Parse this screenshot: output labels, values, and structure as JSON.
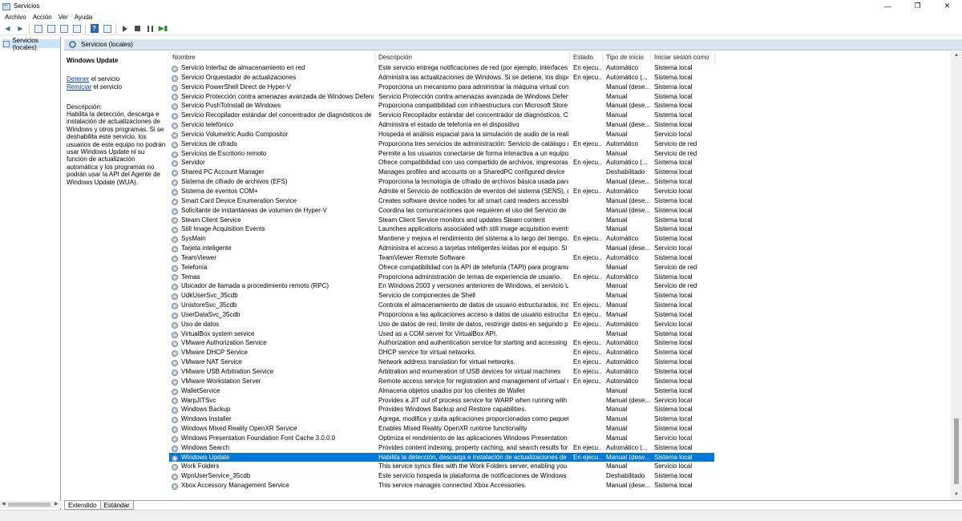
{
  "window": {
    "title": "Servicios",
    "controls": [
      "—",
      "❐",
      "✕"
    ]
  },
  "menu": [
    "Archivo",
    "Acción",
    "Ver",
    "Ayuda"
  ],
  "tree": {
    "root_label": "Servicios (locales)"
  },
  "pane_header": {
    "title": "Servicios (locales)"
  },
  "details": {
    "service_title": "Windows Update",
    "stop_link": "Detener",
    "stop_suffix": " el servicio",
    "restart_link": "Reiniciar",
    "restart_suffix": " el servicio",
    "description_label": "Descripción:",
    "description_text": "Habilita la detección, descarga e instalación de actualizaciones de Windows y otros programas. Si se deshabilita este servicio, los usuarios de este equipo no podrán usar Windows Update ni su función de actualización automática y los programas no podrán usar la API del Agente de Windows Update (WUA)."
  },
  "columns": {
    "name": "Nombre",
    "description": "Descripción",
    "state": "Estado",
    "startup": "Tipo de inicio",
    "logon": "Iniciar sesión como"
  },
  "services": [
    [
      "Servicio Interfaz de almacenamiento en red",
      "Este servicio entrega notificaciones de red (por ejemplo, interfaces ag...",
      "En ejecu...",
      "Automático",
      "Sistema local"
    ],
    [
      "Servicio Orquestador de actualizaciones",
      "Administra las actualizaciones de Windows. Si se detiene, los dispositi...",
      "En ejecu...",
      "Automático (...",
      "Sistema local"
    ],
    [
      "Servicio PowerShell Direct de Hyper-V",
      "Proporciona un mecanismo para administrar la máquina virtual con ...",
      "",
      "Manual (dese...",
      "Sistema local"
    ],
    [
      "Servicio Protección contra amenazas avanzada de Windows Defender",
      "Servicio Protección contra amenazas avanzada de Windows Defend...",
      "",
      "Manual",
      "Sistema local"
    ],
    [
      "Servicio PushToInstall de Windows",
      "Proporciona compatibilidad con infraestructura con Microsoft Store. E...",
      "",
      "Manual (dese...",
      "Sistema local"
    ],
    [
      "Servicio Recopilador estándar del concentrador de diagnósticos de Micr...",
      "Servicio Recopilador estándar del concentrador de diagnósticos. Cua...",
      "",
      "Manual",
      "Sistema local"
    ],
    [
      "Servicio telefónico",
      "Administra el estado de telefonía en el dispositivo",
      "",
      "Manual (dese...",
      "Sistema local"
    ],
    [
      "Servicio Volumetric Audio Compositor",
      "Hospeda el análisis espacial para la simulación de audio de la realidad...",
      "",
      "Manual",
      "Servicio local"
    ],
    [
      "Servicios de cifrado",
      "Proporciona tres servicios de administración: Servicio de catálogo de ...",
      "En ejecu...",
      "Automático",
      "Servicio de red"
    ],
    [
      "Servicios de Escritorio remoto",
      "Permite a los usuarios conectarse de forma interactiva a un equipo re...",
      "",
      "Manual",
      "Servicio de red"
    ],
    [
      "Servidor",
      "Ofrece compatibilidad con uso compartido de archivos, impresoras y ...",
      "En ejecu...",
      "Automático (...",
      "Sistema local"
    ],
    [
      "Shared PC Account Manager",
      "Manages profiles and accounts on a SharedPC configured device",
      "",
      "Deshabilitado",
      "Sistema local"
    ],
    [
      "Sistema de cifrado de archivos (EFS)",
      "Proporciona la tecnología de cifrado de archivos básica usada para al...",
      "",
      "Manual (dese...",
      "Sistema local"
    ],
    [
      "Sistema de eventos COM+",
      "Admite el Servicio de notificación de eventos del sistema (SENS), que ...",
      "En ejecu...",
      "Automático",
      "Servicio local"
    ],
    [
      "Smart Card Device Enumeration Service",
      "Creates software device nodes for all smart card readers accessible to ...",
      "",
      "Manual (dese...",
      "Sistema local"
    ],
    [
      "Solicitante de instantáneas de volumen de Hyper-V",
      "Coordina las comunicaciones que requieren el uso del Servicio de ins...",
      "",
      "Manual (dese...",
      "Sistema local"
    ],
    [
      "Steam Client Service",
      "Steam Client Service monitors and updates Steam content",
      "",
      "Manual",
      "Sistema local"
    ],
    [
      "Still Image Acquisition Events",
      "Launches applications associated with still image acquisition events.",
      "",
      "Manual",
      "Sistema local"
    ],
    [
      "SysMain",
      "Mantiene y mejora el rendimiento del sistema a lo largo del tiempo.",
      "En ejecu...",
      "Automático",
      "Sistema local"
    ],
    [
      "Tarjeta inteligente",
      "Administra el acceso a tarjetas inteligentes leídas por el equipo. Si se ...",
      "",
      "Manual (dese...",
      "Servicio local"
    ],
    [
      "TeamViewer",
      "TeamViewer Remote Software",
      "En ejecu...",
      "Automático",
      "Sistema local"
    ],
    [
      "Telefonía",
      "Ofrece compatibilidad con la API de telefonía (TAPI) para programas ...",
      "",
      "Manual",
      "Servicio de red"
    ],
    [
      "Temas",
      "Proporciona administración de temas de experiencia de usuario.",
      "En ejecu...",
      "Automático",
      "Sistema local"
    ],
    [
      "Ubicador de llamada a procedimiento remoto (RPC)",
      "En Windows 2003 y versiones anteriores de Windows, el servicio Ubic...",
      "",
      "Manual",
      "Servicio de red"
    ],
    [
      "UdkUserSvc_35cdb",
      "Servicio de componentes de Shell",
      "",
      "Manual",
      "Sistema local"
    ],
    [
      "UnistoreSvc_35cdb",
      "Controla el almacenamiento de datos de usuario estructurados, inclui...",
      "En ejecu...",
      "Manual",
      "Sistema local"
    ],
    [
      "UserDataSvc_35cdb",
      "Proporciona a las aplicaciones acceso a datos de usuario estructurad...",
      "En ejecu...",
      "Manual",
      "Sistema local"
    ],
    [
      "Uso de datos",
      "Uso de datos de red, límite de datos, restringir datos en segundo plan...",
      "En ejecu...",
      "Automático",
      "Servicio local"
    ],
    [
      "VirtualBox system service",
      "Used as a COM server for VirtualBox API.",
      "",
      "Manual",
      "Sistema local"
    ],
    [
      "VMware Authorization Service",
      "Authorization and authentication service for starting and accessing vi...",
      "En ejecu...",
      "Automático",
      "Sistema local"
    ],
    [
      "VMware DHCP Service",
      "DHCP service for virtual networks.",
      "En ejecu...",
      "Automático",
      "Sistema local"
    ],
    [
      "VMware NAT Service",
      "Network address translation for virtual networks.",
      "En ejecu...",
      "Automático",
      "Sistema local"
    ],
    [
      "VMware USB Arbitration Service",
      "Arbitration and enumeration of USB devices for virtual machines",
      "En ejecu...",
      "Automático",
      "Sistema local"
    ],
    [
      "VMware Workstation Server",
      "Remote access service for registration and management of virtual ma...",
      "En ejecu...",
      "Automático",
      "Sistema local"
    ],
    [
      "WalletService",
      "Almacena objetos usados por los clientes de Wallet",
      "",
      "Manual",
      "Sistema local"
    ],
    [
      "WarpJITSvc",
      "Provides a JIT out of process service for WARP when running with AC...",
      "",
      "Manual (dese...",
      "Servicio local"
    ],
    [
      "Windows Backup",
      "Provides Windows Backup and Restore capabilities.",
      "",
      "Manual",
      "Sistema local"
    ],
    [
      "Windows Installer",
      "Agrega, modifica y quita aplicaciones proporcionadas como paquete...",
      "",
      "Manual",
      "Sistema local"
    ],
    [
      "Windows Mixed Reality OpenXR Service",
      "Enables Mixed Reality OpenXR runtime functionality",
      "",
      "Manual",
      "Sistema local"
    ],
    [
      "Windows Presentation Foundation Font Cache 3.0.0.0",
      "Optimiza el rendimiento de las aplicaciones Windows Presentation Fo...",
      "",
      "Manual",
      "Servicio local"
    ],
    [
      "Windows Search",
      "Provides content indexing, property caching, and search results for fil...",
      "En ejecu...",
      "Automático (...",
      "Sistema local"
    ],
    [
      "Windows Update",
      "Habilita la detección, descarga e instalación de actualizaciones de Wi...",
      "En ejecu...",
      "Manual (dese...",
      "Sistema local"
    ],
    [
      "Work Folders",
      "This service syncs files with the Work Folders server, enabling you to ...",
      "",
      "Manual",
      "Servicio local"
    ],
    [
      "WpnUserService_35cdb",
      "Este servicio hospeda la plataforma de notificaciones de Windows qu...",
      "",
      "Deshabilitado",
      "Sistema local"
    ],
    [
      "Xbox Accessory Management Service",
      "This service manages connected Xbox Accessories.",
      "",
      "Manual (dese...",
      "Sistema local"
    ]
  ],
  "selected_service": "Windows Update",
  "tabs": [
    "Extendido",
    "Estándar"
  ],
  "colors": {
    "selection": "#0078d7",
    "header_band": "#d8e4f0",
    "link": "#0645ad"
  }
}
